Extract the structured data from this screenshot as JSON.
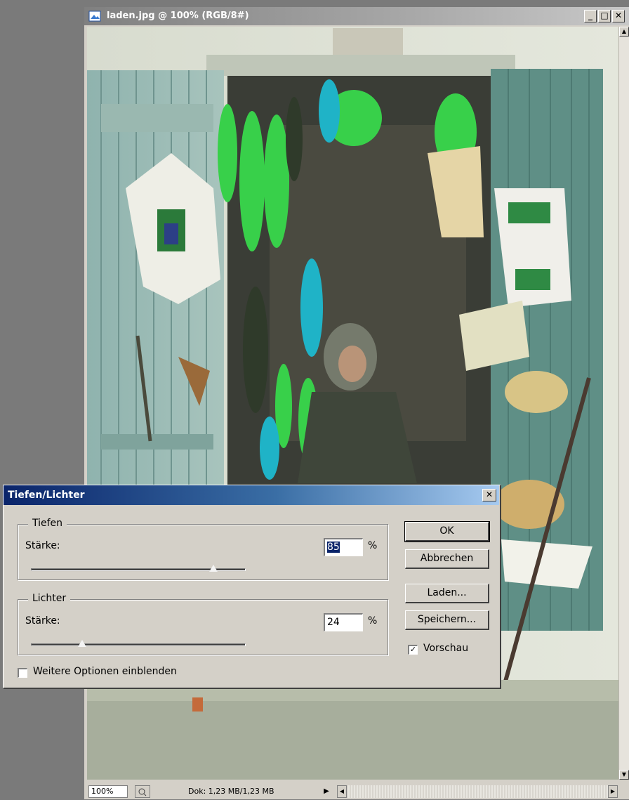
{
  "document": {
    "title": "laden.jpg @ 100% (RGB/8#)",
    "window_buttons": {
      "minimize": "_",
      "maximize": "□",
      "close": "✕"
    },
    "status": {
      "zoom": "100%",
      "doc_info": "Dok: 1,23 MB/1,23 MB"
    }
  },
  "dialog": {
    "title": "Tiefen/Lichter",
    "close": "✕",
    "shadows": {
      "group_label": "Tiefen",
      "amount_label": "Stärke:",
      "value": "85",
      "unit": "%",
      "slider_fraction": 0.85
    },
    "highlights": {
      "group_label": "Lichter",
      "amount_label": "Stärke:",
      "value": "24",
      "unit": "%",
      "slider_fraction": 0.24
    },
    "more_options": {
      "label": "Weitere Optionen einblenden",
      "checked": false
    },
    "buttons": {
      "ok": "OK",
      "cancel": "Abbrechen",
      "load": "Laden...",
      "save": "Speichern..."
    },
    "preview": {
      "label": "Vorschau",
      "checked": true,
      "mark": "✓"
    }
  },
  "colors": {
    "dialog_titlebar": "#0a246a",
    "face": "#d4d0c8"
  }
}
